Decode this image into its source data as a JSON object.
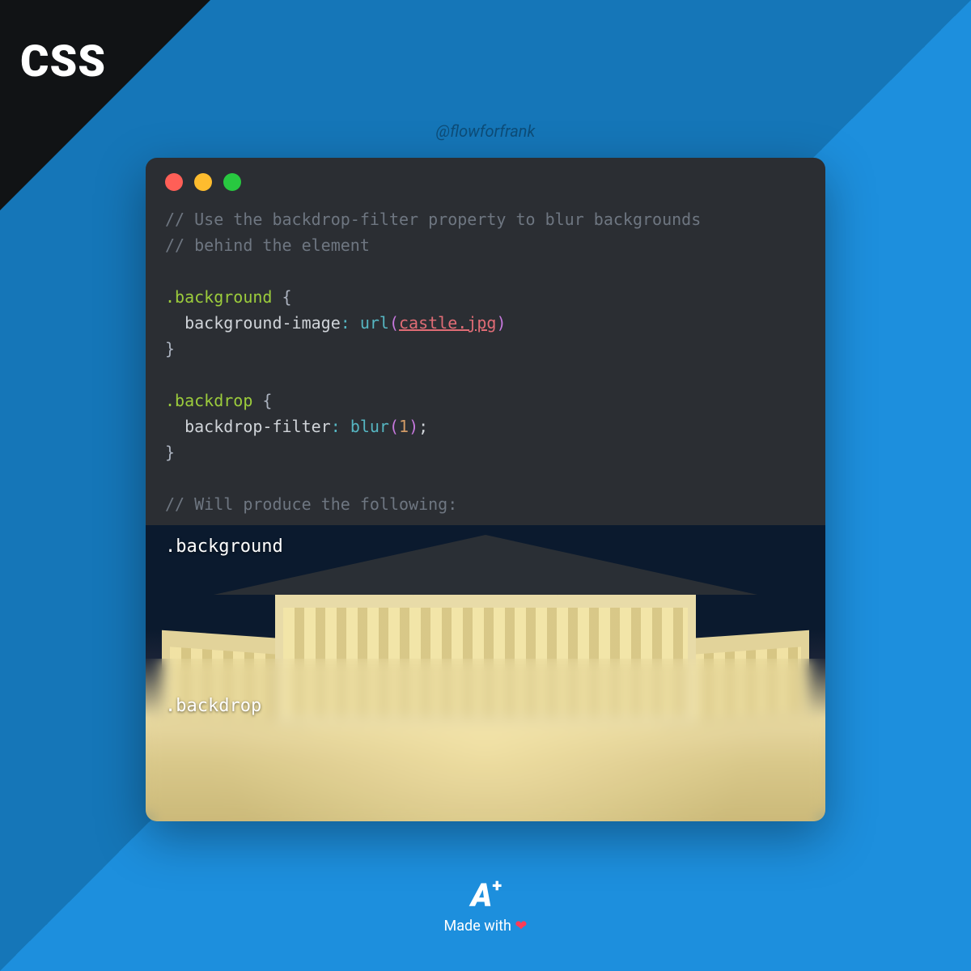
{
  "corner": {
    "label": "CSS"
  },
  "handle": "@flowforfrank",
  "code": {
    "comment1": "// Use the backdrop-filter property to blur backgrounds",
    "comment2": "// behind the element",
    "selector1": ".background",
    "brace_open": "{",
    "prop1": "background-image",
    "fn_url": "url",
    "url_value": "castle.jpg",
    "brace_close": "}",
    "selector2": ".backdrop",
    "prop2": "backdrop-filter",
    "fn_blur": "blur",
    "blur_value": "1",
    "semicolon": ";",
    "comment3": "// Will produce the following:"
  },
  "demo": {
    "label_top": ".background",
    "label_bottom": ".backdrop"
  },
  "footer": {
    "logo": "A",
    "logo_plus": "+",
    "made": "Made with",
    "heart": "❤"
  }
}
